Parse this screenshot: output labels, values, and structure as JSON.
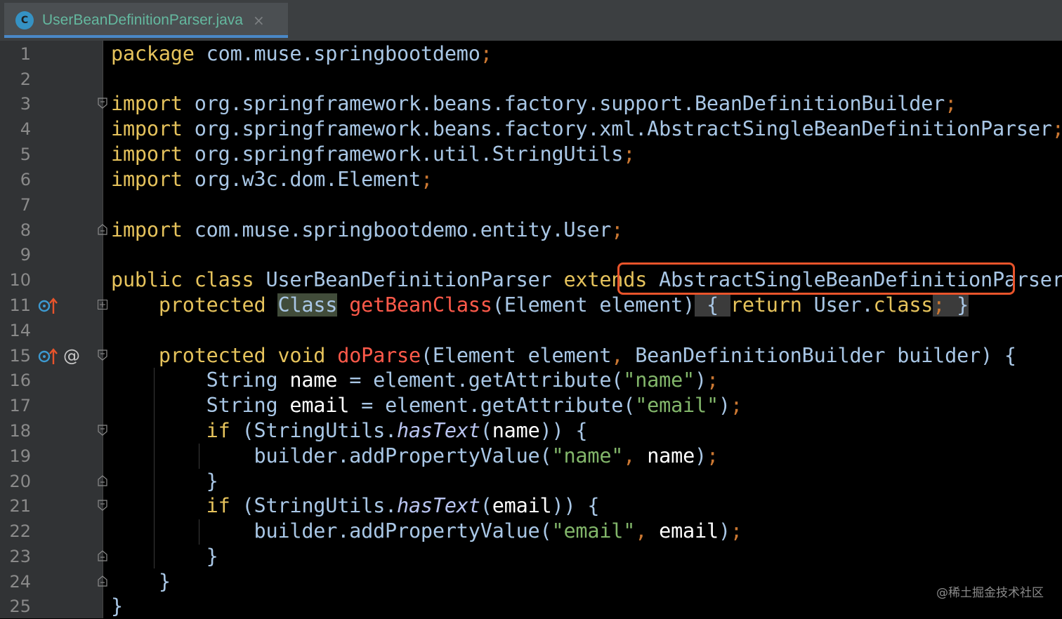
{
  "tab": {
    "icon_letter": "C",
    "title": "UserBeanDefinitionParser.java",
    "close": "×"
  },
  "lines": [
    {
      "num": "1"
    },
    {
      "num": "2"
    },
    {
      "num": "3"
    },
    {
      "num": "4"
    },
    {
      "num": "5"
    },
    {
      "num": "6"
    },
    {
      "num": "7"
    },
    {
      "num": "8"
    },
    {
      "num": "9"
    },
    {
      "num": "10"
    },
    {
      "num": "11"
    },
    {
      "num": "14"
    },
    {
      "num": "15"
    },
    {
      "num": "16"
    },
    {
      "num": "17"
    },
    {
      "num": "18"
    },
    {
      "num": "19"
    },
    {
      "num": "20"
    },
    {
      "num": "21"
    },
    {
      "num": "22"
    },
    {
      "num": "23"
    },
    {
      "num": "24"
    },
    {
      "num": "25"
    }
  ],
  "code": {
    "l1": {
      "kw": "package",
      "rest": " com.muse.springbootdemo",
      "semi": ";"
    },
    "l3": {
      "kw": "import",
      "rest": " org.springframework.beans.factory.support.BeanDefinitionBuilder",
      "semi": ";"
    },
    "l4": {
      "kw": "import",
      "rest": " org.springframework.beans.factory.xml.AbstractSingleBeanDefinitionParser",
      "semi": ";"
    },
    "l5": {
      "kw": "import",
      "rest": " org.springframework.util.StringUtils",
      "semi": ";"
    },
    "l6": {
      "kw": "import",
      "rest": " org.w3c.dom.Element",
      "semi": ";"
    },
    "l8": {
      "kw": "import",
      "rest": " com.muse.springbootdemo.entity.User",
      "semi": ";"
    },
    "l10": {
      "kw": "public class",
      "name": " UserBeanDefinitionParser ",
      "kw2": "extends",
      "parent": "AbstractSingleBeanDefinitionParser",
      "brace": " {"
    },
    "l11": {
      "indent": "    ",
      "kw": "protected",
      "sp": " ",
      "type": "Class",
      "sp2": " ",
      "method": "getBeanClass",
      "args": "(Element element)",
      "fold_open": " { ",
      "kw2": "return",
      "rest": " User.",
      "kw3": "class",
      "semi": ";",
      "fold_close": " }"
    },
    "l15": {
      "indent": "    ",
      "kw": "protected void",
      "sp": " ",
      "method": "doParse",
      "args1": "(Element element",
      "comma": ",",
      "args2": " BeanDefinitionBuilder builder) {"
    },
    "l16": {
      "indent": "        ",
      "type": "String ",
      "var": "name",
      "rest": " = element.getAttribute(",
      "str": "\"name\"",
      "close": ")",
      "semi": ";"
    },
    "l17": {
      "indent": "        ",
      "type": "String ",
      "var": "email",
      "rest": " = element.getAttribute(",
      "str": "\"email\"",
      "close": ")",
      "semi": ";"
    },
    "l18": {
      "indent": "        ",
      "kw": "if",
      "rest": " (StringUtils.",
      "ital": "hasText",
      "open": "(",
      "var": "name",
      "close": ")) {"
    },
    "l19": {
      "indent": "            ",
      "rest": "builder.addPropertyValue(",
      "str": "\"name\"",
      "comma": ",",
      "sp": " ",
      "var": "name",
      "close": ")",
      "semi": ";"
    },
    "l20": {
      "indent": "        ",
      "text": "}"
    },
    "l21": {
      "indent": "        ",
      "kw": "if",
      "rest": " (StringUtils.",
      "ital": "hasText",
      "open": "(",
      "var": "email",
      "close": ")) {"
    },
    "l22": {
      "indent": "            ",
      "rest": "builder.addPropertyValue(",
      "str": "\"email\"",
      "comma": ",",
      "sp": " ",
      "var": "email",
      "close": ")",
      "semi": ";"
    },
    "l23": {
      "indent": "        ",
      "text": "}"
    },
    "l24": {
      "indent": "    ",
      "text": "}"
    },
    "l25": {
      "text": "}"
    }
  },
  "gutter_icons": {
    "l11_override": "o↑",
    "l15_override": "o↑",
    "l15_at": "@"
  },
  "watermark": "@稀土掘金技术社区",
  "colors": {
    "keyword": "#e0c46c",
    "string": "#82b66a",
    "method": "#ff5a4a",
    "highlight": "#e8542b",
    "tab_accent": "#4a88c7"
  }
}
